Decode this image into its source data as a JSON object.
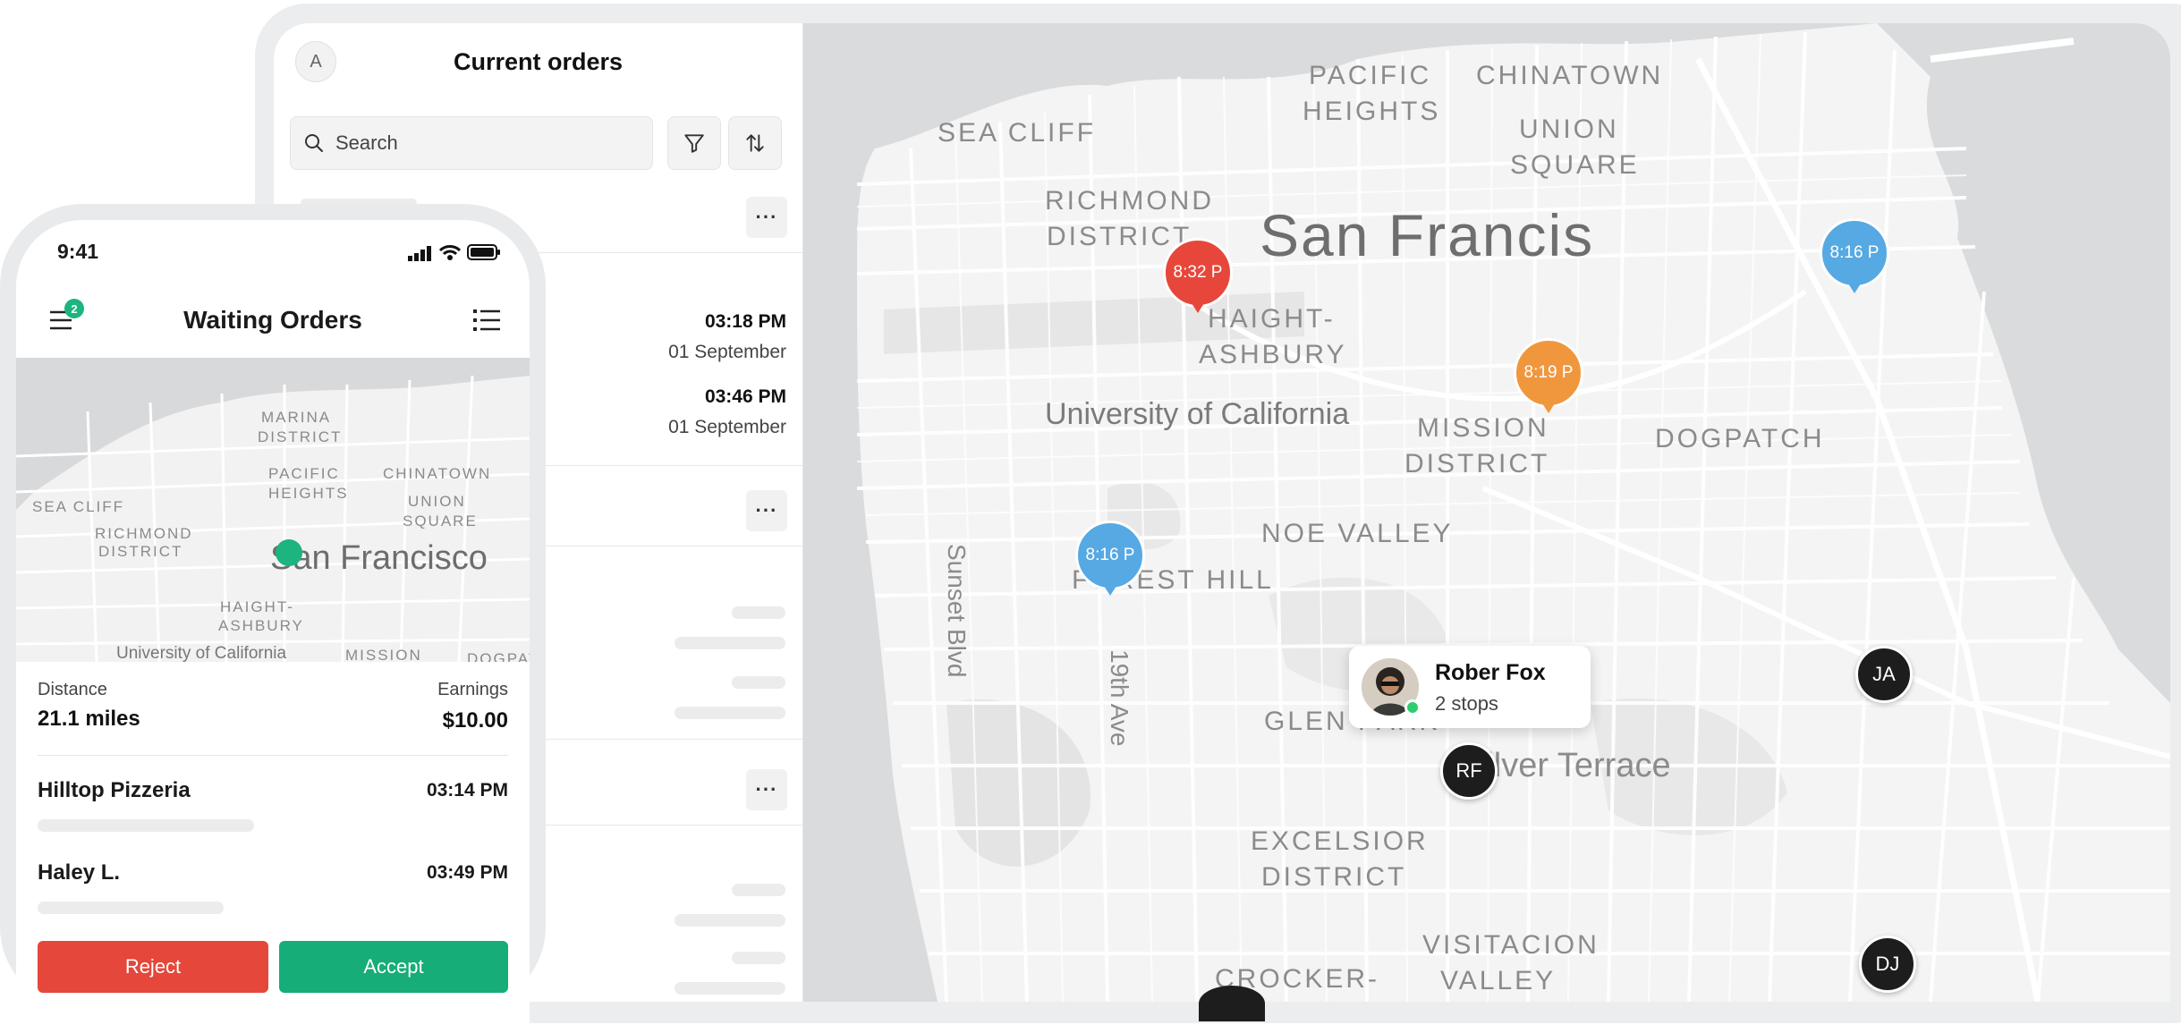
{
  "tablet": {
    "avatar_initial": "A",
    "title": "Current orders",
    "search_placeholder": "Search",
    "orders": [
      {
        "time1": "03:18 PM",
        "date1": "01 September",
        "time2": "03:46 PM",
        "date2": "01 September"
      }
    ],
    "more_label": "···"
  },
  "map": {
    "labels": {
      "city": "San Francis",
      "pacific_heights_1": "PACIFIC",
      "pacific_heights_2": "HEIGHTS",
      "chinatown": "CHINATOWN",
      "union_1": "UNION",
      "union_2": "SQUARE",
      "sea_cliff": "SEA CLIFF",
      "richmond_1": "RICHMOND",
      "richmond_2": "DISTRICT",
      "haight_1": "HAIGHT-",
      "haight_2": "ASHBURY",
      "university": "University of California",
      "mission_1": "MISSION",
      "mission_2": "DISTRICT",
      "dogpatch": "DOGPATCH",
      "noe": "NOE VALLEY",
      "forest": "FOREST HILL",
      "sunset": "Sunset Blvd",
      "ave19": "19th Ave",
      "glen": "GLEN PARK",
      "silver": "Silver Terrace",
      "excelsior_1": "EXCELSIOR",
      "excelsior_2": "DISTRICT",
      "crocker": "CROCKER-",
      "visitacion_1": "VISITACION",
      "visitacion_2": "VALLEY"
    },
    "pins": [
      {
        "label": "8:32 P",
        "color": "#e7473a"
      },
      {
        "label": "8:16 P",
        "color": "#56a9e3"
      },
      {
        "label": "8:19 P",
        "color": "#f0973e"
      },
      {
        "label": "8:16 P",
        "color": "#56a9e3"
      }
    ],
    "drivers": {
      "jas": "JA",
      "rf": "RF",
      "dj": "DJ"
    },
    "driver_card": {
      "name": "Rober Fox",
      "stops": "2 stops",
      "online_color": "#2ecc71"
    }
  },
  "phone": {
    "clock": "9:41",
    "title": "Waiting Orders",
    "menu_badge": "2",
    "map_labels": {
      "marina_1": "MARINA",
      "marina_2": "DISTRICT",
      "pacific_1": "PACIFIC",
      "pacific_2": "HEIGHTS",
      "chinatown": "CHINATOWN",
      "union_1": "UNION",
      "union_2": "SQUARE",
      "sea_cliff": "SEA CLIFF",
      "richmond_1": "RICHMOND",
      "richmond_2": "DISTRICT",
      "city": "San Francisco",
      "haight_1": "HAIGHT-",
      "haight_2": "ASHBURY",
      "university": "University of California",
      "mission": "MISSION",
      "dogpatch": "DOGPAT"
    },
    "distance_label": "Distance",
    "distance_value": "21.1 miles",
    "earnings_label": "Earnings",
    "earnings_value": "$10.00",
    "stops": [
      {
        "name": "Hilltop Pizzeria",
        "time": "03:14 PM"
      },
      {
        "name": "Haley L.",
        "time": "03:49 PM"
      }
    ],
    "reject_label": "Reject",
    "accept_label": "Accept",
    "colors": {
      "reject": "#e5473b",
      "accept": "#16ad78"
    }
  }
}
